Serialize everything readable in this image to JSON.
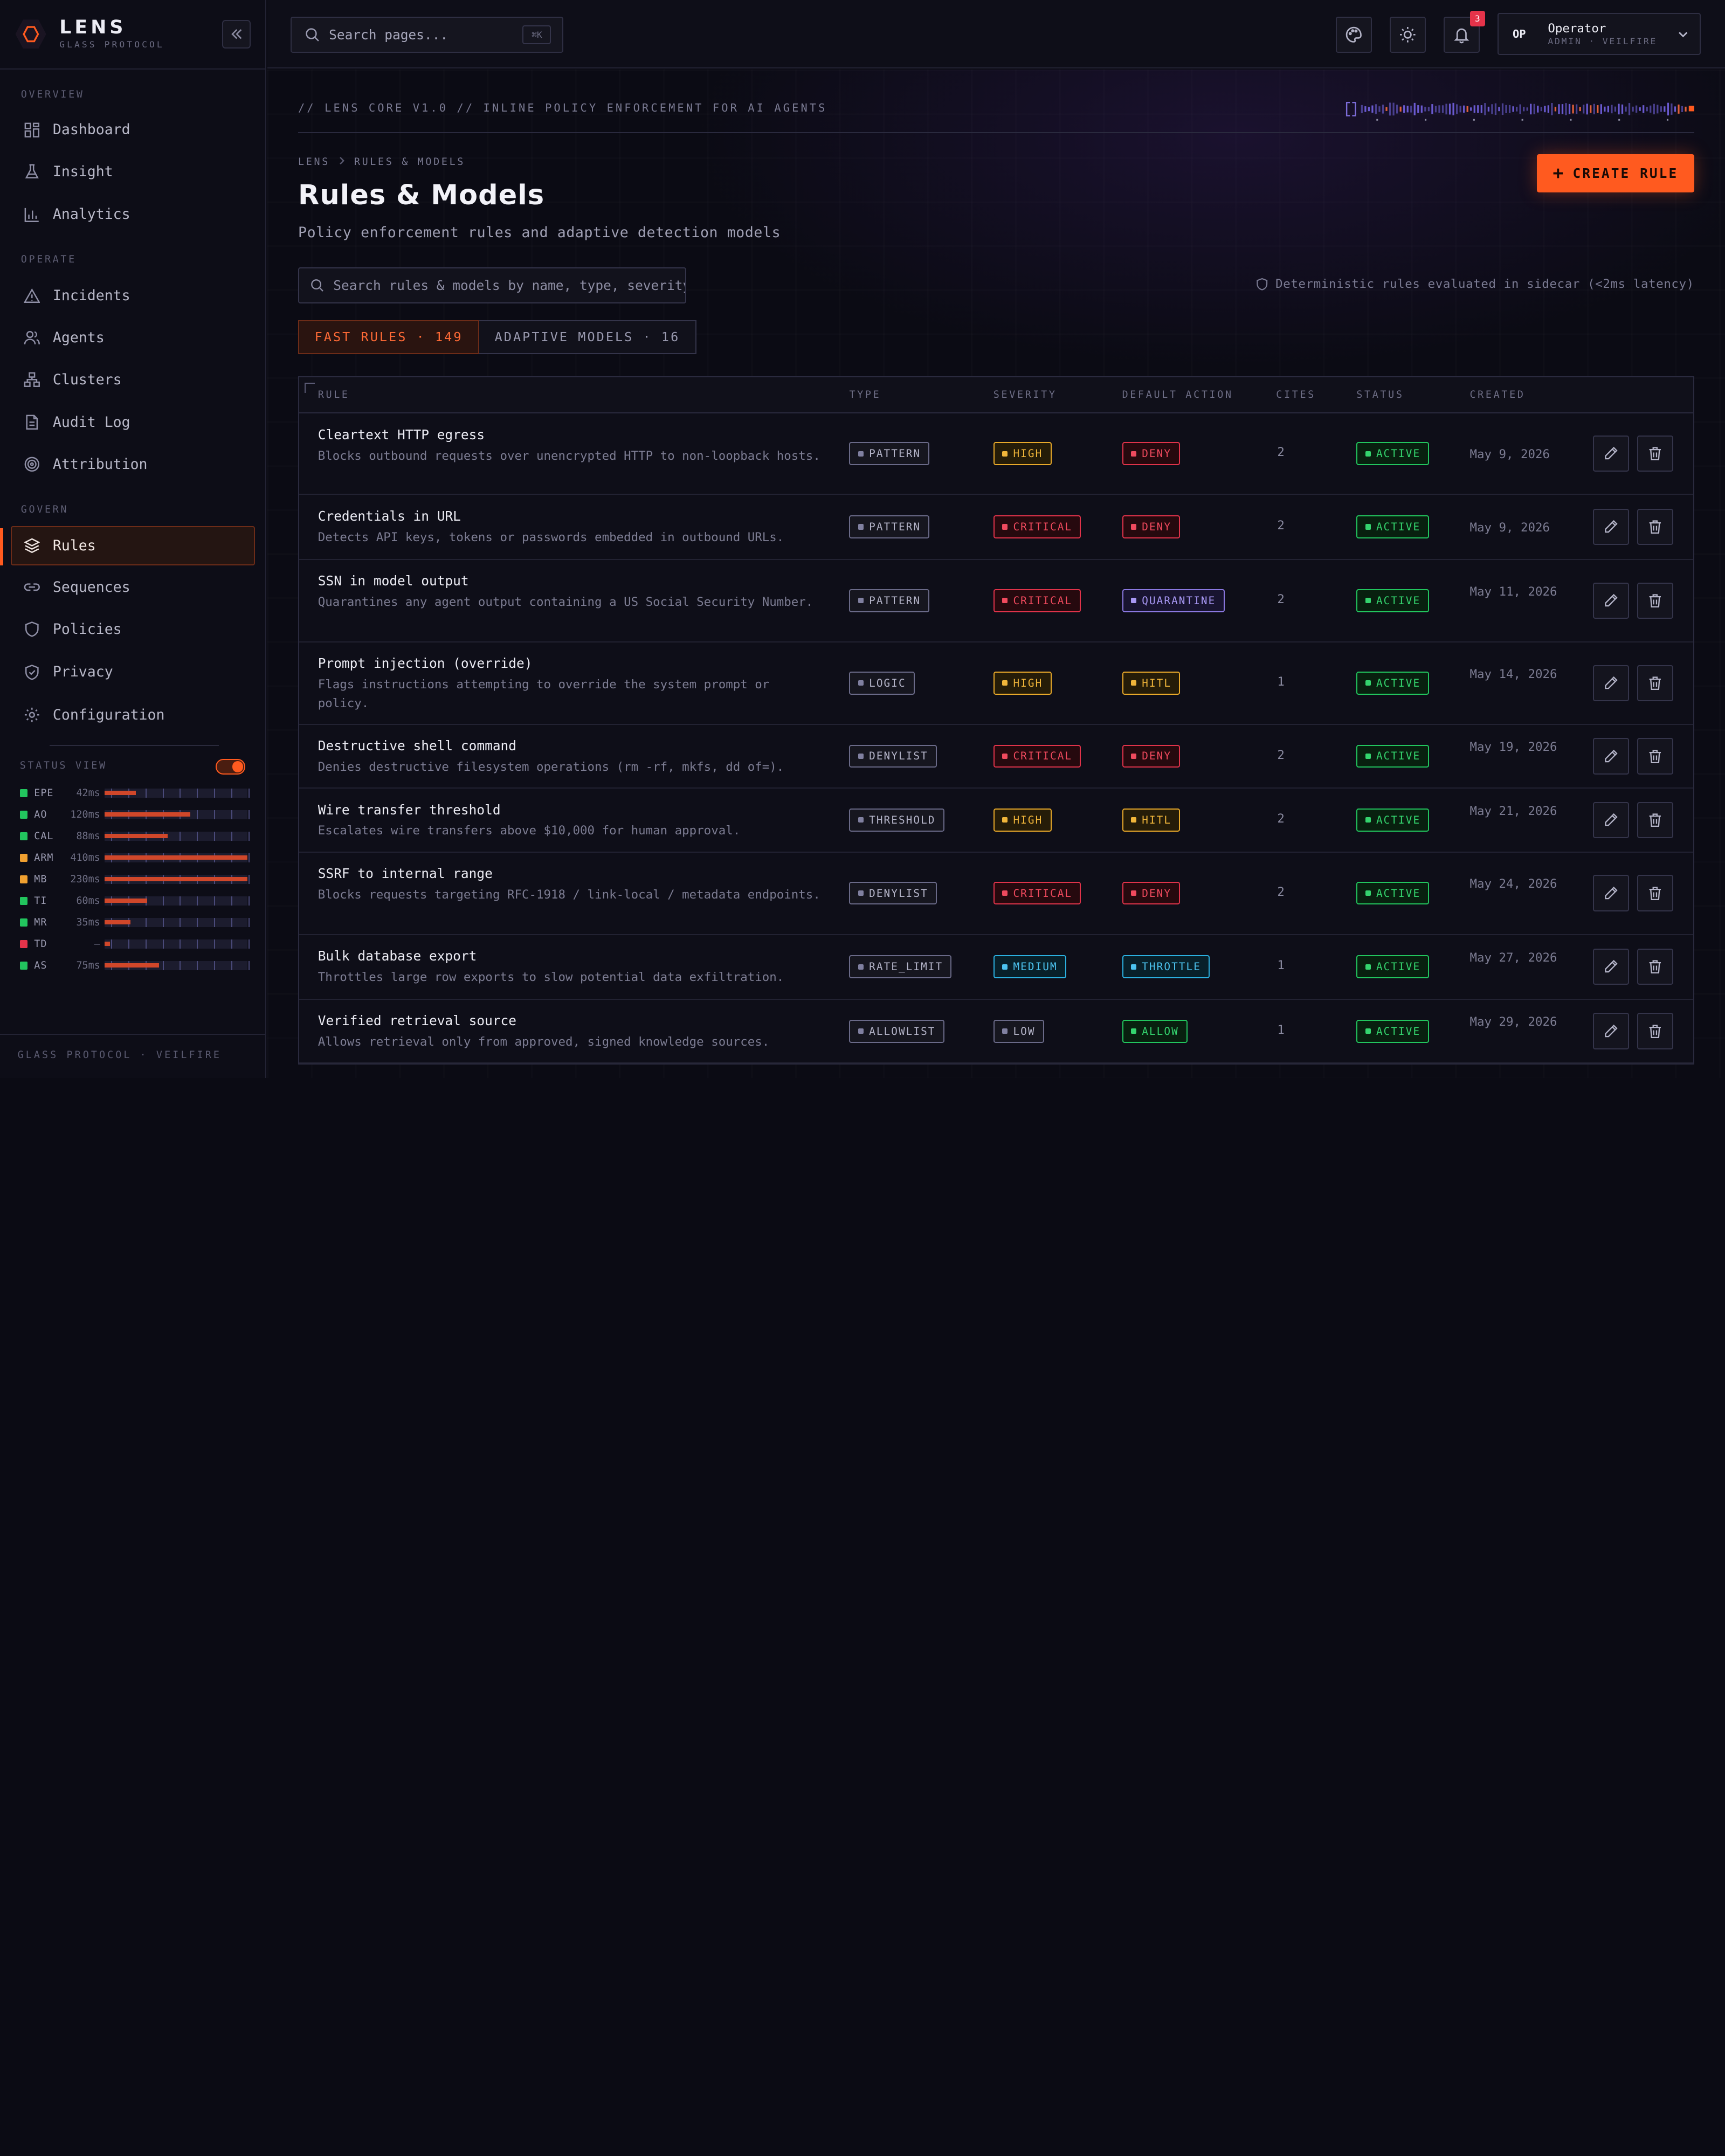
{
  "brand": {
    "name": "LENS",
    "sub": "GLASS PROTOCOL"
  },
  "sidebar": {
    "sections": {
      "overview": "OVERVIEW",
      "operate": "OPERATE",
      "govern": "GOVERN"
    },
    "items": [
      {
        "label": "Dashboard",
        "icon": "grid-icon"
      },
      {
        "label": "Insight",
        "icon": "flask-icon"
      },
      {
        "label": "Analytics",
        "icon": "bar-chart-icon"
      },
      {
        "label": "Incidents",
        "icon": "warning-icon"
      },
      {
        "label": "Agents",
        "icon": "users-icon"
      },
      {
        "label": "Clusters",
        "icon": "network-icon"
      },
      {
        "label": "Audit Log",
        "icon": "document-icon"
      },
      {
        "label": "Attribution",
        "icon": "target-icon"
      },
      {
        "label": "Rules",
        "icon": "layers-icon",
        "active": true
      },
      {
        "label": "Sequences",
        "icon": "link-icon"
      },
      {
        "label": "Policies",
        "icon": "shield-icon"
      },
      {
        "label": "Privacy",
        "icon": "shield-check-icon"
      },
      {
        "label": "Configuration",
        "icon": "gear-icon"
      }
    ],
    "status_view": {
      "title": "STATUS VIEW",
      "enabled": true,
      "rows": [
        {
          "name": "EPE",
          "ms": "42ms",
          "color": "#22c55e",
          "level": 0.22
        },
        {
          "name": "AO",
          "ms": "120ms",
          "color": "#22c55e",
          "level": 0.6
        },
        {
          "name": "CAL",
          "ms": "88ms",
          "color": "#22c55e",
          "level": 0.44
        },
        {
          "name": "ARM",
          "ms": "410ms",
          "color": "#f0a030",
          "level": 1.0
        },
        {
          "name": "MB",
          "ms": "230ms",
          "color": "#f0a030",
          "level": 1.0
        },
        {
          "name": "TI",
          "ms": "60ms",
          "color": "#22c55e",
          "level": 0.3
        },
        {
          "name": "MR",
          "ms": "35ms",
          "color": "#22c55e",
          "level": 0.18
        },
        {
          "name": "TD",
          "ms": "—",
          "color": "#e5334a",
          "level": 0.04
        },
        {
          "name": "AS",
          "ms": "75ms",
          "color": "#22c55e",
          "level": 0.38
        }
      ]
    },
    "footer": "GLASS PROTOCOL · VEILFIRE"
  },
  "topbar": {
    "search_placeholder": "Search pages...",
    "search_kbd": "⌘K",
    "notifications": "3",
    "user": {
      "initials": "OP",
      "name": "Operator",
      "role": "ADMIN · VEILFIRE"
    }
  },
  "main": {
    "tagline": "// LENS CORE V1.0  //  INLINE POLICY ENFORCEMENT FOR AI AGENTS",
    "breadcrumb": [
      "LENS",
      "RULES & MODELS"
    ],
    "title": "Rules & Models",
    "subtitle": "Policy enforcement rules and adaptive detection models",
    "create_label": "CREATE RULE",
    "filter_placeholder": "Search rules & models by name, type, severity...",
    "sidecar_note": "Deterministic rules evaluated in sidecar (<2ms latency)",
    "tabs": [
      {
        "label": "FAST RULES · 149",
        "active": true
      },
      {
        "label": "ADAPTIVE MODELS · 16",
        "active": false
      }
    ],
    "columns": [
      "RULE",
      "TYPE",
      "SEVERITY",
      "DEFAULT ACTION",
      "CITES",
      "STATUS",
      "CREATED"
    ],
    "rows": [
      {
        "name": "Cleartext HTTP egress",
        "desc": "Blocks outbound requests over unencrypted HTTP to non-loopback hosts.",
        "type": "PATTERN",
        "severity": "HIGH",
        "action": "DENY",
        "cites": "2",
        "status": "ACTIVE",
        "created": "May 9, 2026"
      },
      {
        "name": "Credentials in URL",
        "desc": "Detects API keys, tokens or passwords embedded in outbound URLs.",
        "type": "PATTERN",
        "severity": "CRITICAL",
        "action": "DENY",
        "cites": "2",
        "status": "ACTIVE",
        "created": "May 9, 2026"
      },
      {
        "name": "SSN in model output",
        "desc": "Quarantines any agent output containing a US Social Security Number.",
        "type": "PATTERN",
        "severity": "CRITICAL",
        "action": "QUARANTINE",
        "cites": "2",
        "status": "ACTIVE",
        "created": "May 11, 2026"
      },
      {
        "name": "Prompt injection (override)",
        "desc": "Flags instructions attempting to override the system prompt or policy.",
        "type": "LOGIC",
        "severity": "HIGH",
        "action": "HITL",
        "cites": "1",
        "status": "ACTIVE",
        "created": "May 14, 2026"
      },
      {
        "name": "Destructive shell command",
        "desc": "Denies destructive filesystem operations (rm -rf, mkfs, dd of=).",
        "type": "DENYLIST",
        "severity": "CRITICAL",
        "action": "DENY",
        "cites": "2",
        "status": "ACTIVE",
        "created": "May 19, 2026"
      },
      {
        "name": "Wire transfer threshold",
        "desc": "Escalates wire transfers above $10,000 for human approval.",
        "type": "THRESHOLD",
        "severity": "HIGH",
        "action": "HITL",
        "cites": "2",
        "status": "ACTIVE",
        "created": "May 21, 2026"
      },
      {
        "name": "SSRF to internal range",
        "desc": "Blocks requests targeting RFC-1918 / link-local / metadata endpoints.",
        "type": "DENYLIST",
        "severity": "CRITICAL",
        "action": "DENY",
        "cites": "2",
        "status": "ACTIVE",
        "created": "May 24, 2026"
      },
      {
        "name": "Bulk database export",
        "desc": "Throttles large row exports to slow potential data exfiltration.",
        "type": "RATE_LIMIT",
        "severity": "MEDIUM",
        "action": "THROTTLE",
        "cites": "1",
        "status": "ACTIVE",
        "created": "May 27, 2026"
      },
      {
        "name": "Verified retrieval source",
        "desc": "Allows retrieval only from approved, signed knowledge sources.",
        "type": "ALLOWLIST",
        "severity": "LOW",
        "action": "ALLOW",
        "cites": "1",
        "status": "ACTIVE",
        "created": "May 29, 2026"
      }
    ]
  },
  "colors": {
    "accent": "#ff5a1f",
    "success": "#22c55e",
    "warning": "#f0b53a",
    "danger": "#f04a5e",
    "info": "#4cc3ef",
    "purple": "#a898f4"
  }
}
